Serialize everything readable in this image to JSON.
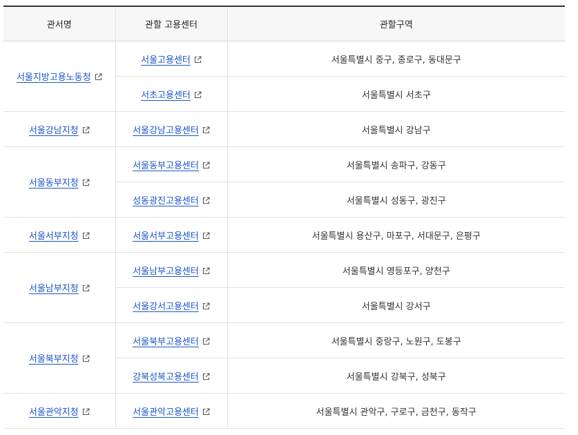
{
  "headers": [
    "관서명",
    "관할 고용센터",
    "관할구역"
  ],
  "offices": [
    {
      "name": "서울지방고용노동청",
      "centers": [
        {
          "name": "서울고용센터",
          "area": "서울특별시 중구, 종로구, 동대문구"
        },
        {
          "name": "서초고용센터",
          "area": "서울특별시 서초구"
        }
      ]
    },
    {
      "name": "서울강남지청",
      "centers": [
        {
          "name": "서울강남고용센터",
          "area": "서울특별시 강남구"
        }
      ]
    },
    {
      "name": "서울동부지청",
      "centers": [
        {
          "name": "서울동부고용센터",
          "area": "서울특별시 송파구, 강동구"
        },
        {
          "name": "성동광진고용센터",
          "area": "서울특별시 성동구, 광진구"
        }
      ]
    },
    {
      "name": "서울서부지청",
      "centers": [
        {
          "name": "서울서부고용센터",
          "area": "서울특별시 용산구, 마포구, 서대문구, 은평구"
        }
      ]
    },
    {
      "name": "서울남부지청",
      "centers": [
        {
          "name": "서울남부고용센터",
          "area": "서울특별시 영등포구, 양천구"
        },
        {
          "name": "서울강서고용센터",
          "area": "서울특별시 강서구"
        }
      ]
    },
    {
      "name": "서울북부지청",
      "centers": [
        {
          "name": "서울북부고용센터",
          "area": "서울특별시 중랑구, 노원구, 도봉구"
        },
        {
          "name": "강북성북고용센터",
          "area": "서울특별시 강북구, 성북구"
        }
      ]
    },
    {
      "name": "서울관악지청",
      "centers": [
        {
          "name": "서울관악고용센터",
          "area": "서울특별시 관악구, 구로구, 금천구, 동작구"
        }
      ]
    }
  ],
  "icons": {
    "external": "external-link-icon"
  },
  "colors": {
    "link": "#1a55c7",
    "header_bg": "#f7f7f7",
    "header_top_border": "#333333"
  }
}
